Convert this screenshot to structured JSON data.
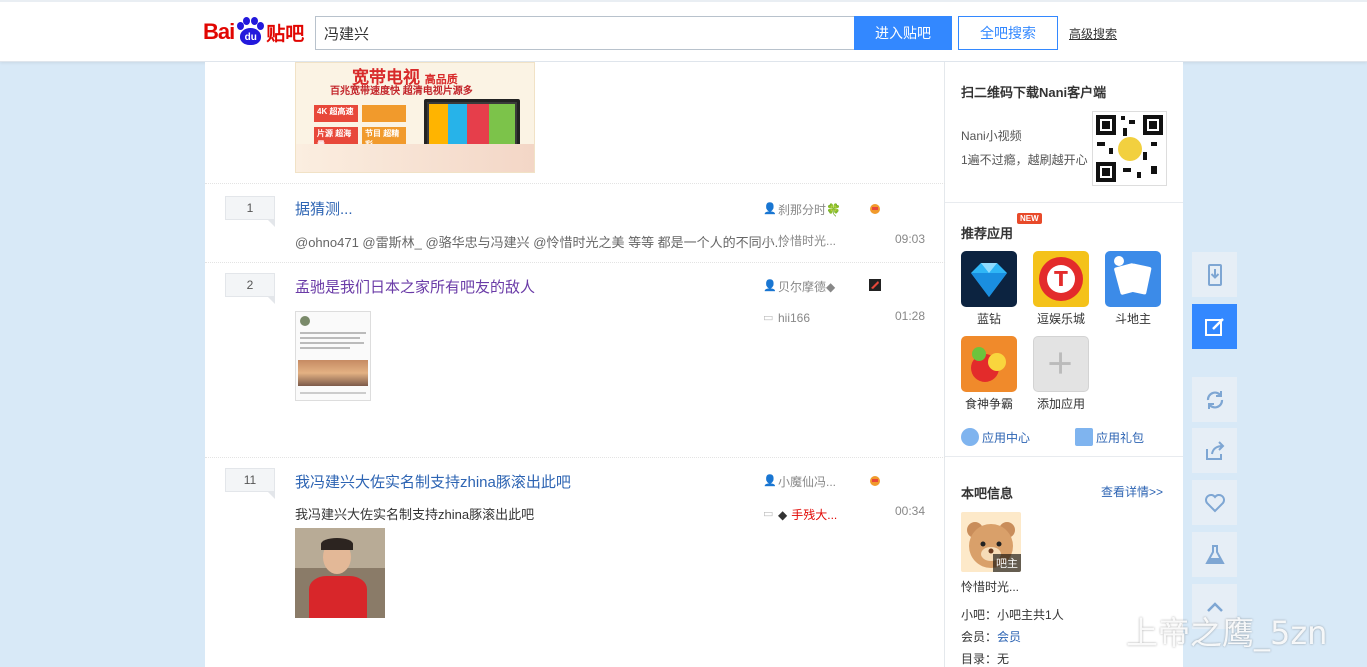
{
  "header": {
    "logo_text": "Bai",
    "logo_du": "du",
    "logo_tieba": "贴吧",
    "search_value": "冯建兴",
    "enter_button": "进入贴吧",
    "all_search_button": "全吧搜索",
    "advanced_link": "高级搜索"
  },
  "ad": {
    "title": "宽带电视",
    "title_small": "高品质",
    "subtitle": "百兆宽带速度快 超清电视片源多",
    "tiles": [
      "4K",
      "超高速",
      "片源",
      "超海量",
      "节目",
      "超精彩"
    ]
  },
  "threads": [
    {
      "reply_count": "1",
      "title": "据猜测...",
      "abstract": "@ohno471 @雷斯林_ @骆华忠与冯建兴 @怜惜时光之美 等等 都是一个人的不同小...",
      "author": "刹那分时🍀",
      "last_reply": "怜惜时光...",
      "time": "09:03"
    },
    {
      "reply_count": "2",
      "title": "孟驰是我们日本之家所有吧友的敌人",
      "author": "贝尔摩德◆",
      "last_reply": "hii166",
      "time": "01:28"
    },
    {
      "reply_count": "11",
      "title": "我冯建兴大佐实名制支持zhina豚滚出此吧",
      "abstract": "我冯建兴大佐实名制支持zhina豚滚出此吧",
      "author": "小魔仙冯...",
      "last_reply_prefix": "◆",
      "last_reply": "手残大...",
      "time": "00:34"
    }
  ],
  "sidebar": {
    "qr_section": {
      "title": "扫二维码下载Nani客户端",
      "app_name": "Nani小视频",
      "slogan": "1遍不过瘾，越刷越开心"
    },
    "apps_section": {
      "title": "推荐应用",
      "new_badge": "NEW",
      "apps": [
        "蓝钻",
        "逗娱乐城",
        "斗地主",
        "食神争霸",
        "添加应用"
      ],
      "app_center": "应用中心",
      "app_gift": "应用礼包"
    },
    "info_section": {
      "title": "本吧信息",
      "detail_link": "查看详情>>",
      "owner_tag": "吧主",
      "owner_name": "怜惜时光...",
      "line1_label": "小吧：",
      "line1_value": "小吧主共1人",
      "line2_label": "会员：",
      "line2_value": "会员",
      "line3_label": "目录：",
      "line3_value": "无"
    }
  },
  "watermark": "上帝之鹰_5zn",
  "colors": {
    "accent": "#3388ff",
    "brand_red": "#e10602",
    "link": "#2d64b3",
    "background": "#d8e9f7"
  }
}
